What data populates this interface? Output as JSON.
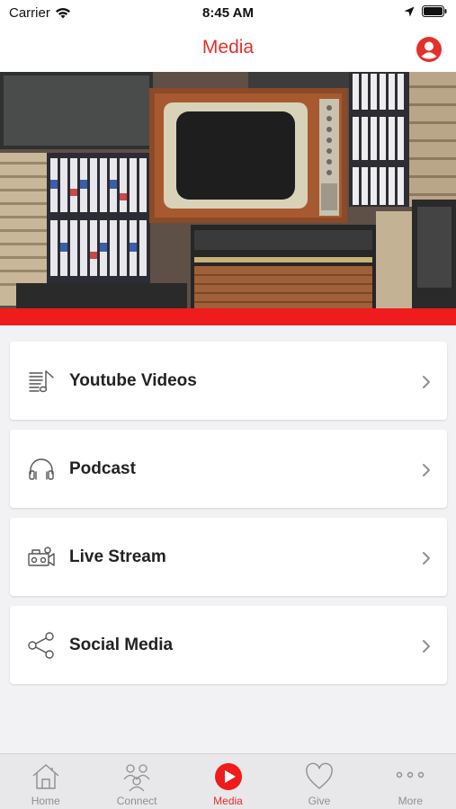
{
  "status_bar": {
    "carrier": "Carrier",
    "time": "8:45 AM"
  },
  "nav": {
    "title": "Media"
  },
  "menu": [
    {
      "label": "Youtube Videos",
      "icon": "playlist-music-icon"
    },
    {
      "label": "Podcast",
      "icon": "headphones-icon"
    },
    {
      "label": "Live Stream",
      "icon": "video-camera-icon"
    },
    {
      "label": "Social Media",
      "icon": "share-icon"
    }
  ],
  "tabs": [
    {
      "label": "Home",
      "icon": "home-icon"
    },
    {
      "label": "Connect",
      "icon": "people-icon"
    },
    {
      "label": "Media",
      "icon": "play-circle-icon",
      "active": true
    },
    {
      "label": "Give",
      "icon": "heart-icon"
    },
    {
      "label": "More",
      "icon": "more-dots-icon"
    }
  ],
  "colors": {
    "accent": "#e5302a",
    "strip": "#ee1c1c",
    "inactive": "#8e8e93"
  }
}
